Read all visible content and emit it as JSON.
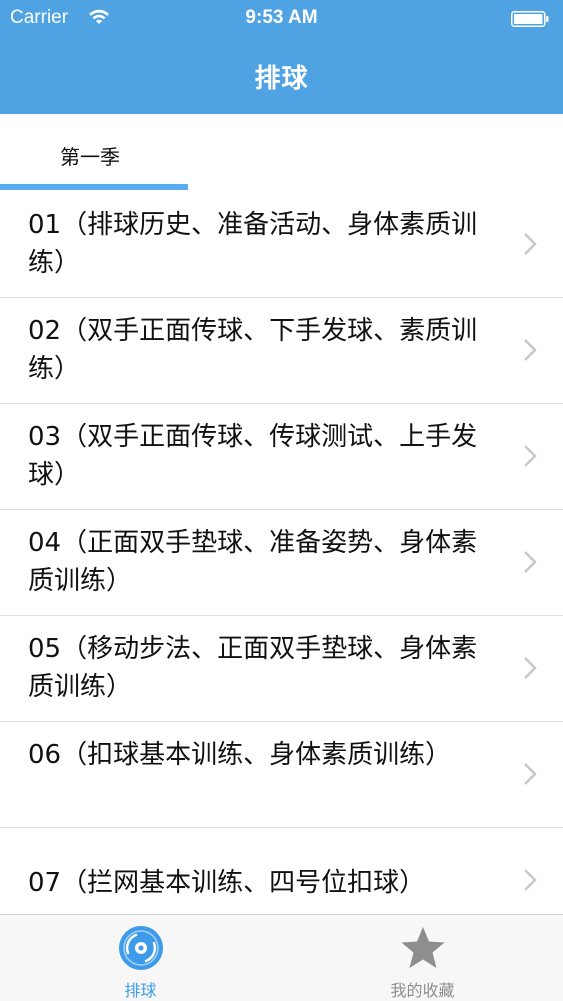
{
  "status_bar": {
    "carrier": "Carrier",
    "time": "9:53 AM"
  },
  "nav": {
    "title": "排球"
  },
  "season_tabs": [
    {
      "label": "第一季",
      "selected": true
    }
  ],
  "episodes": [
    {
      "label": "01（排球历史、准备活动、身体素质训练）"
    },
    {
      "label": "02（双手正面传球、下手发球、素质训练）"
    },
    {
      "label": "03（双手正面传球、传球测试、上手发球）"
    },
    {
      "label": "04（正面双手垫球、准备姿势、身体素质训练）"
    },
    {
      "label": "05（移动步法、正面双手垫球、身体素质训练）"
    },
    {
      "label": "06（扣球基本训练、身体素质训练）"
    },
    {
      "label": "07（拦网基本训练、四号位扣球）"
    }
  ],
  "tabbar": {
    "items": [
      {
        "label": "排球",
        "icon": "volleyball-disc-icon",
        "active": true
      },
      {
        "label": "我的收藏",
        "icon": "star-icon",
        "active": false
      }
    ]
  },
  "colors": {
    "nav_blue": "#4fa3e3",
    "accent_blue": "#3d9be9",
    "inactive_gray": "#8e8e8e"
  }
}
